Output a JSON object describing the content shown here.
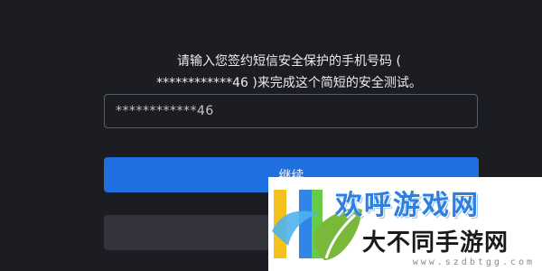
{
  "instruction": {
    "line1": "请输入您签约短信安全保护的手机号码 (",
    "line2": "************46 )来完成这个简短的安全测试。"
  },
  "phone_field": {
    "value": "************46"
  },
  "buttons": {
    "continue_label": "继续",
    "secondary_label": ""
  },
  "watermark": {
    "site_name": "欢呼游戏网",
    "slogan": "大不同手游网",
    "url": "www.szdbtgg.com",
    "logo_icon": "leaf-logo-icon"
  },
  "colors": {
    "background": "#1c1d23",
    "primary_button": "#1f6fe0",
    "secondary_button": "#33343b",
    "input_border": "#5a5c66"
  }
}
